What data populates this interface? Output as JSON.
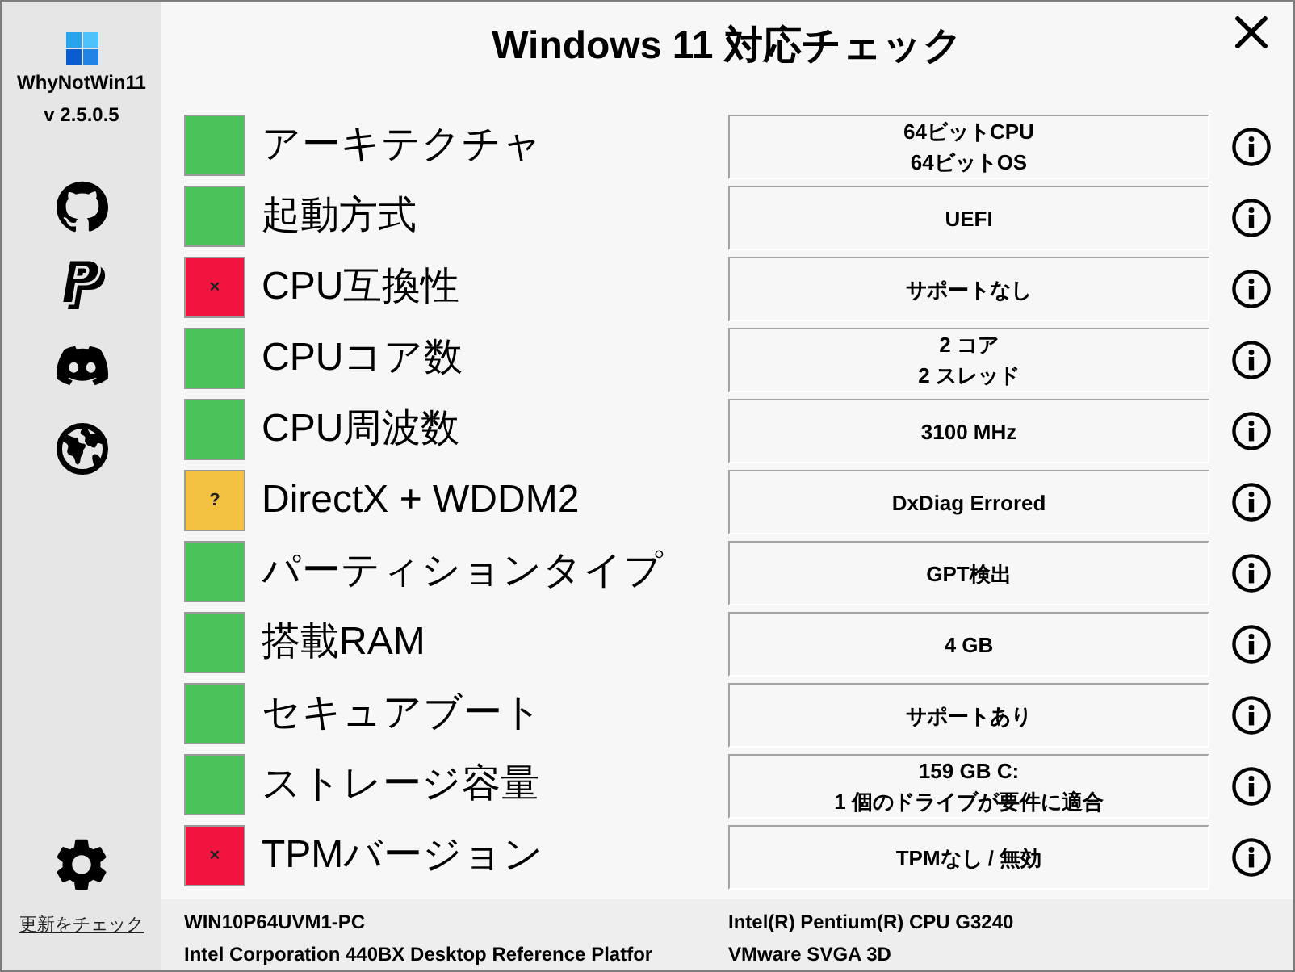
{
  "window": {
    "title": "Windows 11 対応チェック"
  },
  "sidebar": {
    "app_name": "WhyNotWin11",
    "version": "v 2.5.0.5",
    "update_link": "更新をチェック"
  },
  "checks": [
    {
      "label": "アーキテクチャ",
      "color": "#4bc25a",
      "result": [
        "64ビットCPU",
        "64ビットOS"
      ]
    },
    {
      "label": "起動方式",
      "color": "#4bc25a",
      "result": [
        "UEFI"
      ]
    },
    {
      "label": "CPU互換性",
      "color": "#f0143f",
      "mark": "×",
      "result": [
        "サポートなし"
      ]
    },
    {
      "label": "CPUコア数",
      "color": "#4bc25a",
      "result": [
        "2 コア",
        "2 スレッド"
      ]
    },
    {
      "label": "CPU周波数",
      "color": "#4bc25a",
      "result": [
        "3100 MHz"
      ]
    },
    {
      "label": "DirectX + WDDM2",
      "color": "#f4c243",
      "mark": "?",
      "result": [
        "DxDiag Errored"
      ]
    },
    {
      "label": "パーティションタイプ",
      "color": "#4bc25a",
      "result": [
        "GPT検出"
      ]
    },
    {
      "label": "搭載RAM",
      "color": "#4bc25a",
      "result": [
        "4 GB"
      ]
    },
    {
      "label": "セキュアブート",
      "color": "#4bc25a",
      "result": [
        "サポートあり"
      ]
    },
    {
      "label": "ストレージ容量",
      "color": "#4bc25a",
      "result": [
        "159 GB C:",
        "1 個のドライブが要件に適合"
      ]
    },
    {
      "label": "TPMバージョン",
      "color": "#f0143f",
      "mark": "×",
      "result": [
        "TPMなし / 無効"
      ]
    }
  ],
  "status_bar": {
    "pc_name": "WIN10P64UVM1-PC",
    "cpu": "Intel(R) Pentium(R) CPU G3240",
    "motherboard": "Intel Corporation 440BX Desktop Reference Platfor",
    "gpu": "VMware SVGA 3D"
  }
}
